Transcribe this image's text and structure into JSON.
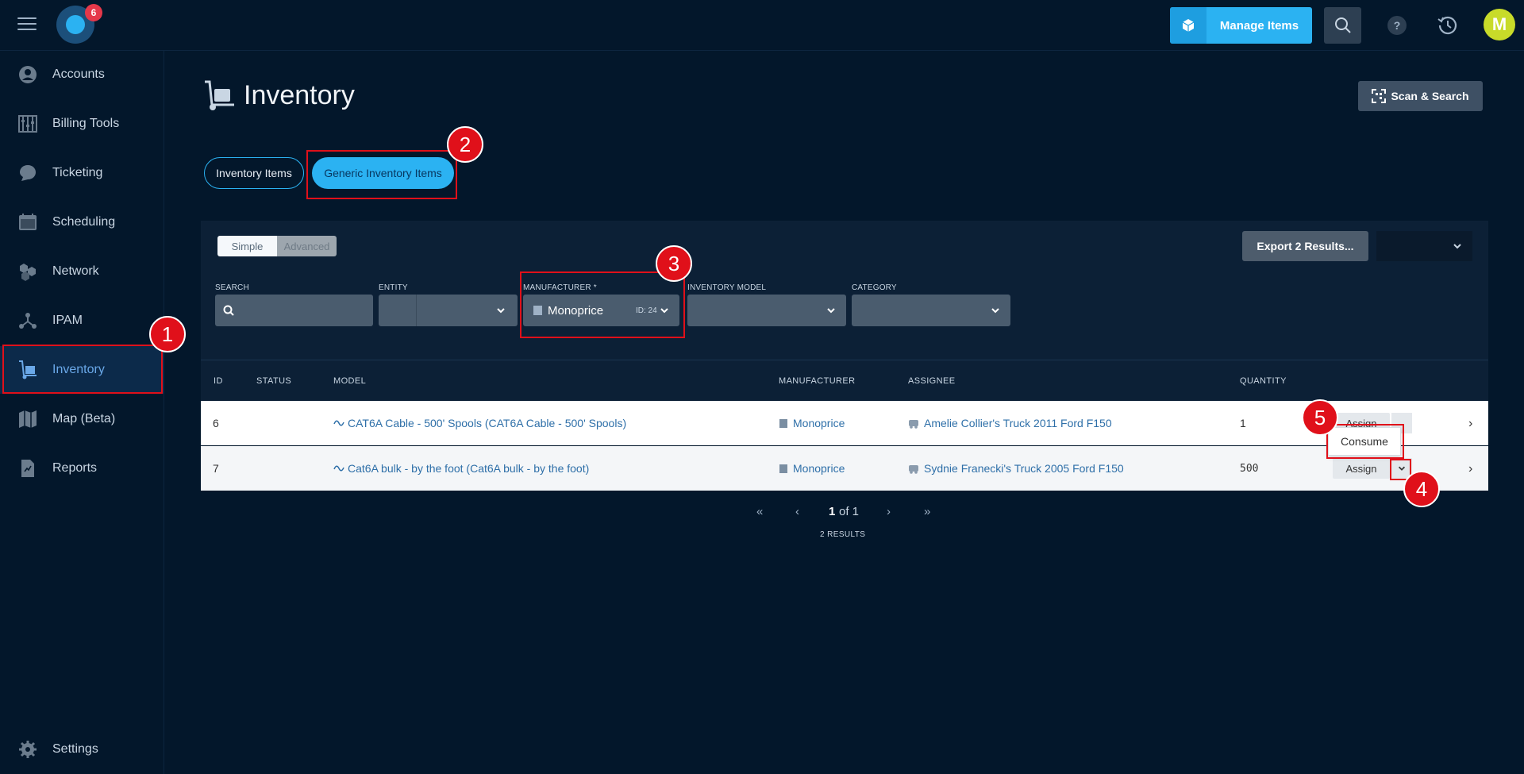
{
  "topbar": {
    "notification_count": "6",
    "manage_items_label": "Manage Items",
    "help_label": "?",
    "avatar_initial": "M",
    "accent_color": "#2bb2f2"
  },
  "sidebar": {
    "items": [
      {
        "label": "Accounts",
        "icon": "person-circle-icon"
      },
      {
        "label": "Billing Tools",
        "icon": "abacus-icon"
      },
      {
        "label": "Ticketing",
        "icon": "chat-bubble-icon"
      },
      {
        "label": "Scheduling",
        "icon": "calendar-icon"
      },
      {
        "label": "Network",
        "icon": "hexagons-icon"
      },
      {
        "label": "IPAM",
        "icon": "nodes-icon"
      },
      {
        "label": "Inventory",
        "icon": "hand-truck-icon",
        "active": true
      },
      {
        "label": "Map (Beta)",
        "icon": "map-icon"
      },
      {
        "label": "Reports",
        "icon": "report-icon"
      }
    ],
    "settings_label": "Settings"
  },
  "page": {
    "title": "Inventory",
    "scan_search_label": "Scan & Search",
    "tabs": [
      {
        "label": "Inventory Items",
        "active": false
      },
      {
        "label": "Generic Inventory Items",
        "active": true
      }
    ]
  },
  "filters": {
    "mode_simple": "Simple",
    "mode_advanced": "Advanced",
    "export_label": "Export 2 Results...",
    "search_label": "SEARCH",
    "entity_label": "ENTITY",
    "manufacturer_label": "MANUFACTURER *",
    "manufacturer_value": "Monoprice",
    "manufacturer_id": "ID: 24",
    "inventory_model_label": "INVENTORY MODEL",
    "category_label": "CATEGORY"
  },
  "table": {
    "columns": [
      "ID",
      "STATUS",
      "MODEL",
      "MANUFACTURER",
      "ASSIGNEE",
      "QUANTITY"
    ],
    "rows": [
      {
        "id": "6",
        "status": "",
        "model": "CAT6A Cable - 500' Spools (CAT6A Cable - 500' Spools)",
        "manufacturer": "Monoprice",
        "assignee": "Amelie Collier's Truck 2011 Ford F150",
        "quantity": "1",
        "action": "Assign"
      },
      {
        "id": "7",
        "status": "",
        "model": "Cat6A bulk - by the foot (Cat6A bulk - by the foot)",
        "manufacturer": "Monoprice",
        "assignee": "Sydnie Franecki's Truck 2005 Ford F150",
        "quantity": "500",
        "action": "Assign"
      }
    ],
    "popup_option": "Consume"
  },
  "pagination": {
    "first": "«",
    "prev": "‹",
    "page_current": "1",
    "page_of": "of 1",
    "next": "›",
    "last": "»",
    "results": "2 RESULTS"
  },
  "annotations": [
    "1",
    "2",
    "3",
    "4",
    "5"
  ]
}
